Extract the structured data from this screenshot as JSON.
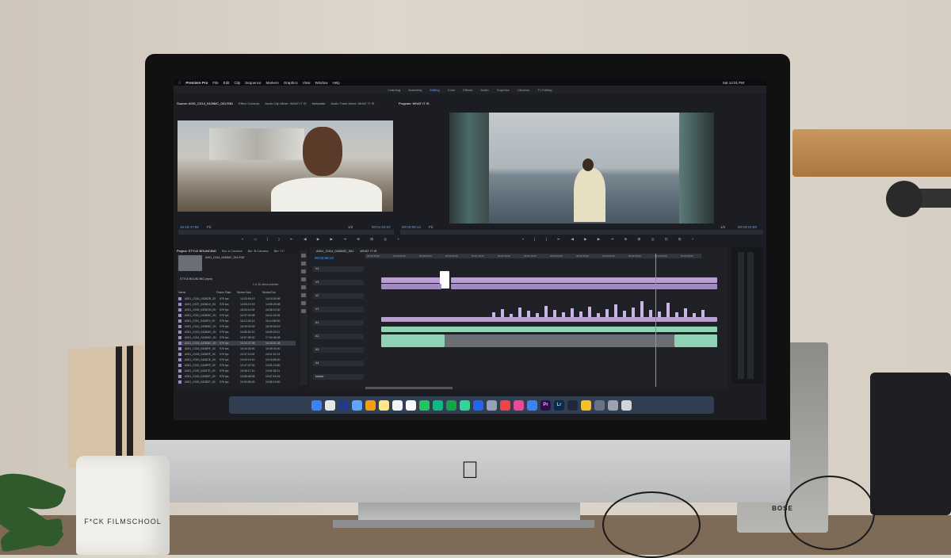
{
  "mug": {
    "text": "F*CK FILMSCHOOL"
  },
  "speaker": {
    "brand": "BOSE"
  },
  "menubar": {
    "app": "Premiere Pro",
    "items": [
      "File",
      "Edit",
      "Clip",
      "Sequence",
      "Markers",
      "Graphics",
      "View",
      "Window",
      "Help"
    ],
    "clock": "Sat 12:01 PM"
  },
  "workspaces": {
    "items": [
      "Learning",
      "Assembly",
      "Editing",
      "Color",
      "Effects",
      "Audio",
      "Graphics",
      "Libraries",
      "TV Editing"
    ],
    "active": "Editing"
  },
  "source_panel": {
    "tabs": [
      "Source: A001_C014_0426MC_001.R3D",
      "Effect Controls",
      "Audio Clip Mixer: WHAT IT IS",
      "Metadata",
      "Audio Track Mixer: WHAT IT IS"
    ],
    "timecode_in": "16:15:47:06",
    "timecode_dur": "00:01:04:02",
    "fit": "Fit",
    "scale": "1/2"
  },
  "program_panel": {
    "tab": "Program: WHAT IT IS",
    "timecode_in": "00:02:59:13",
    "timecode_dur": "00:03:22:09",
    "fit": "Fit",
    "scale": "1/2"
  },
  "project_panel": {
    "tabs": [
      "Project: STYLE BOUNCING",
      "Bin: A Camera",
      "Bin: B Camera",
      "Bin: TC"
    ],
    "file": "A001_C014_0426MC_001.R3D",
    "project_name": "STYLE BOUNCING.prproj",
    "selection": "1 of 111 items selected",
    "columns": [
      "Name",
      "Frame Rate",
      "Media Start",
      "Media End"
    ],
    "rows": [
      {
        "name": "A001_C016_0426DR_00",
        "fps": "976 fps",
        "start": "14:03:09:13",
        "end": "14:10:02:06"
      },
      {
        "name": "A001_C007_0426DX_00",
        "fps": "976 fps",
        "start": "14:53:19:19",
        "end": "14:59:20:08"
      },
      {
        "name": "A001_C009_0426GN_00",
        "fps": "976 fps",
        "start": "16:04:14:09",
        "end": "16:08:10:00"
      },
      {
        "name": "A001_C010_0426MC_00",
        "fps": "976 fps",
        "start": "16:07:49:08",
        "end": "16:11:24:05"
      },
      {
        "name": "A001_C011_0426FX_00",
        "fps": "976 fps",
        "start": "16:12:04:12",
        "end": "16:14:50:00"
      },
      {
        "name": "A001_C012_0426MC_00",
        "fps": "976 fps",
        "start": "16:20:00:09",
        "end": "16:25:09:19"
      },
      {
        "name": "A001_C013_0426MC_00",
        "fps": "976 fps",
        "start": "16:56:52:10",
        "end": "16:59:33:11"
      },
      {
        "name": "A001_C014_0426MC_00",
        "fps": "976 fps",
        "start": "16:57:08:00",
        "end": "17:00:46:08"
      },
      {
        "name": "A001_C015_0426MC_00",
        "fps": "976 fps",
        "start": "16:15:47:06",
        "end": "16:16:51:08"
      },
      {
        "name": "A001_C016_0426RF_00",
        "fps": "976 fps",
        "start": "16:34:33:00",
        "end": "16:39:33:00"
      },
      {
        "name": "A001_C018_0426RF_00",
        "fps": "976 fps",
        "start": "19:07:11:00",
        "end": "19:11:19:13"
      },
      {
        "name": "A001_C019_0426CE_00",
        "fps": "976 fps",
        "start": "19:09:19:10",
        "end": "19:16:55:20"
      },
      {
        "name": "A001_C021_0426RF_00",
        "fps": "976 fps",
        "start": "19:47:47:00",
        "end": "19:51:13:00"
      },
      {
        "name": "A001_C022_0426TE_00",
        "fps": "976 fps",
        "start": "19:48:17:10",
        "end": "19:51:36:11"
      },
      {
        "name": "A001_C023_0426EF_00",
        "fps": "976 fps",
        "start": "19:55:48:08",
        "end": "19:57:15:16"
      },
      {
        "name": "A001_C024_0426EF_00",
        "fps": "976 fps",
        "start": "19:52:55:00",
        "end": "19:56:13:00"
      }
    ]
  },
  "timeline": {
    "tabs": [
      "A001_C014_0426MC_001",
      "WHAT IT IS"
    ],
    "timecode": "00:02:59:13",
    "ruler": [
      "00:00:15:00",
      "00:00:30:00",
      "00:00:45:00",
      "00:01:00:00",
      "00:01:15:00",
      "00:01:30:00",
      "00:01:45:00",
      "00:02:00:00",
      "00:02:15:00",
      "00:02:30:00",
      "00:02:45:00",
      "00:03:00:00",
      "00:03:15:00"
    ],
    "tracks": [
      "V4",
      "V3",
      "V2",
      "V1",
      "A1",
      "A2",
      "A3",
      "A4",
      "Master"
    ]
  },
  "dock": {
    "items": [
      "Finder",
      "Launchpad",
      "Safari",
      "Mail",
      "Photos",
      "Notes",
      "Calendar",
      "Reminders",
      "Maps",
      "Messages",
      "FaceTime",
      "Numbers",
      "Keynote",
      "Preview",
      "News",
      "Music",
      "App Store",
      "Premiere Pro",
      "Lightroom",
      "Final Cut",
      "Finder Folder",
      "System Preferences",
      "Downloads",
      "Trash"
    ],
    "pr_label": "Pr",
    "lr_label": "Lr"
  }
}
